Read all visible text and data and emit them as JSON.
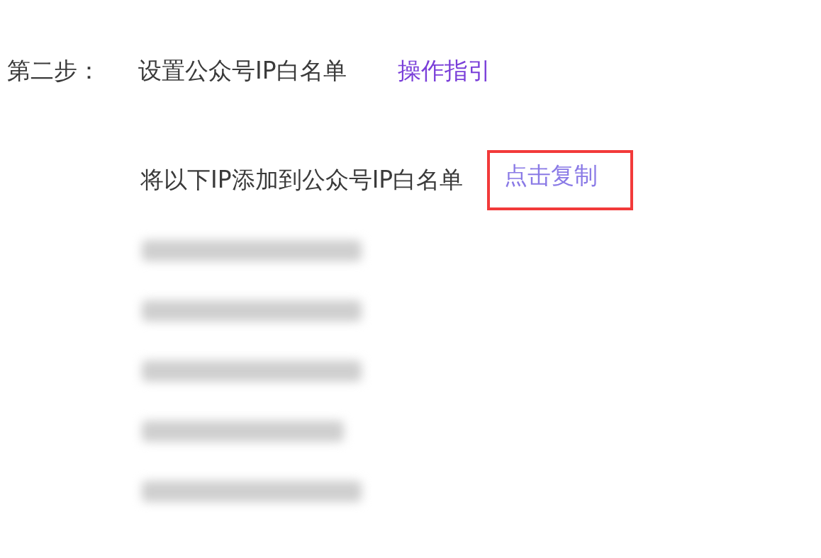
{
  "step": {
    "label": "第二步：",
    "title": "设置公众号IP白名单",
    "guide_link": "操作指引"
  },
  "instruction": {
    "text": "将以下IP添加到公众号IP白名单",
    "copy_link": "点击复制",
    "highlighted": true
  },
  "ip_list": [
    {
      "kind": "redacted"
    },
    {
      "kind": "redacted"
    },
    {
      "kind": "redacted"
    },
    {
      "kind": "redacted"
    },
    {
      "kind": "redacted"
    }
  ]
}
